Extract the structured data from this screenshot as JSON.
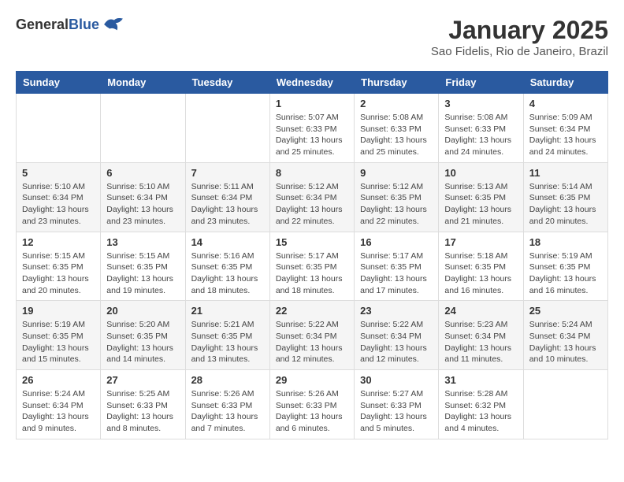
{
  "header": {
    "logo_general": "General",
    "logo_blue": "Blue",
    "month_title": "January 2025",
    "location": "Sao Fidelis, Rio de Janeiro, Brazil"
  },
  "weekdays": [
    "Sunday",
    "Monday",
    "Tuesday",
    "Wednesday",
    "Thursday",
    "Friday",
    "Saturday"
  ],
  "weeks": [
    [
      {
        "day": "",
        "info": ""
      },
      {
        "day": "",
        "info": ""
      },
      {
        "day": "",
        "info": ""
      },
      {
        "day": "1",
        "info": "Sunrise: 5:07 AM\nSunset: 6:33 PM\nDaylight: 13 hours\nand 25 minutes."
      },
      {
        "day": "2",
        "info": "Sunrise: 5:08 AM\nSunset: 6:33 PM\nDaylight: 13 hours\nand 25 minutes."
      },
      {
        "day": "3",
        "info": "Sunrise: 5:08 AM\nSunset: 6:33 PM\nDaylight: 13 hours\nand 24 minutes."
      },
      {
        "day": "4",
        "info": "Sunrise: 5:09 AM\nSunset: 6:34 PM\nDaylight: 13 hours\nand 24 minutes."
      }
    ],
    [
      {
        "day": "5",
        "info": "Sunrise: 5:10 AM\nSunset: 6:34 PM\nDaylight: 13 hours\nand 23 minutes."
      },
      {
        "day": "6",
        "info": "Sunrise: 5:10 AM\nSunset: 6:34 PM\nDaylight: 13 hours\nand 23 minutes."
      },
      {
        "day": "7",
        "info": "Sunrise: 5:11 AM\nSunset: 6:34 PM\nDaylight: 13 hours\nand 23 minutes."
      },
      {
        "day": "8",
        "info": "Sunrise: 5:12 AM\nSunset: 6:34 PM\nDaylight: 13 hours\nand 22 minutes."
      },
      {
        "day": "9",
        "info": "Sunrise: 5:12 AM\nSunset: 6:35 PM\nDaylight: 13 hours\nand 22 minutes."
      },
      {
        "day": "10",
        "info": "Sunrise: 5:13 AM\nSunset: 6:35 PM\nDaylight: 13 hours\nand 21 minutes."
      },
      {
        "day": "11",
        "info": "Sunrise: 5:14 AM\nSunset: 6:35 PM\nDaylight: 13 hours\nand 20 minutes."
      }
    ],
    [
      {
        "day": "12",
        "info": "Sunrise: 5:15 AM\nSunset: 6:35 PM\nDaylight: 13 hours\nand 20 minutes."
      },
      {
        "day": "13",
        "info": "Sunrise: 5:15 AM\nSunset: 6:35 PM\nDaylight: 13 hours\nand 19 minutes."
      },
      {
        "day": "14",
        "info": "Sunrise: 5:16 AM\nSunset: 6:35 PM\nDaylight: 13 hours\nand 18 minutes."
      },
      {
        "day": "15",
        "info": "Sunrise: 5:17 AM\nSunset: 6:35 PM\nDaylight: 13 hours\nand 18 minutes."
      },
      {
        "day": "16",
        "info": "Sunrise: 5:17 AM\nSunset: 6:35 PM\nDaylight: 13 hours\nand 17 minutes."
      },
      {
        "day": "17",
        "info": "Sunrise: 5:18 AM\nSunset: 6:35 PM\nDaylight: 13 hours\nand 16 minutes."
      },
      {
        "day": "18",
        "info": "Sunrise: 5:19 AM\nSunset: 6:35 PM\nDaylight: 13 hours\nand 16 minutes."
      }
    ],
    [
      {
        "day": "19",
        "info": "Sunrise: 5:19 AM\nSunset: 6:35 PM\nDaylight: 13 hours\nand 15 minutes."
      },
      {
        "day": "20",
        "info": "Sunrise: 5:20 AM\nSunset: 6:35 PM\nDaylight: 13 hours\nand 14 minutes."
      },
      {
        "day": "21",
        "info": "Sunrise: 5:21 AM\nSunset: 6:35 PM\nDaylight: 13 hours\nand 13 minutes."
      },
      {
        "day": "22",
        "info": "Sunrise: 5:22 AM\nSunset: 6:34 PM\nDaylight: 13 hours\nand 12 minutes."
      },
      {
        "day": "23",
        "info": "Sunrise: 5:22 AM\nSunset: 6:34 PM\nDaylight: 13 hours\nand 12 minutes."
      },
      {
        "day": "24",
        "info": "Sunrise: 5:23 AM\nSunset: 6:34 PM\nDaylight: 13 hours\nand 11 minutes."
      },
      {
        "day": "25",
        "info": "Sunrise: 5:24 AM\nSunset: 6:34 PM\nDaylight: 13 hours\nand 10 minutes."
      }
    ],
    [
      {
        "day": "26",
        "info": "Sunrise: 5:24 AM\nSunset: 6:34 PM\nDaylight: 13 hours\nand 9 minutes."
      },
      {
        "day": "27",
        "info": "Sunrise: 5:25 AM\nSunset: 6:33 PM\nDaylight: 13 hours\nand 8 minutes."
      },
      {
        "day": "28",
        "info": "Sunrise: 5:26 AM\nSunset: 6:33 PM\nDaylight: 13 hours\nand 7 minutes."
      },
      {
        "day": "29",
        "info": "Sunrise: 5:26 AM\nSunset: 6:33 PM\nDaylight: 13 hours\nand 6 minutes."
      },
      {
        "day": "30",
        "info": "Sunrise: 5:27 AM\nSunset: 6:33 PM\nDaylight: 13 hours\nand 5 minutes."
      },
      {
        "day": "31",
        "info": "Sunrise: 5:28 AM\nSunset: 6:32 PM\nDaylight: 13 hours\nand 4 minutes."
      },
      {
        "day": "",
        "info": ""
      }
    ]
  ]
}
